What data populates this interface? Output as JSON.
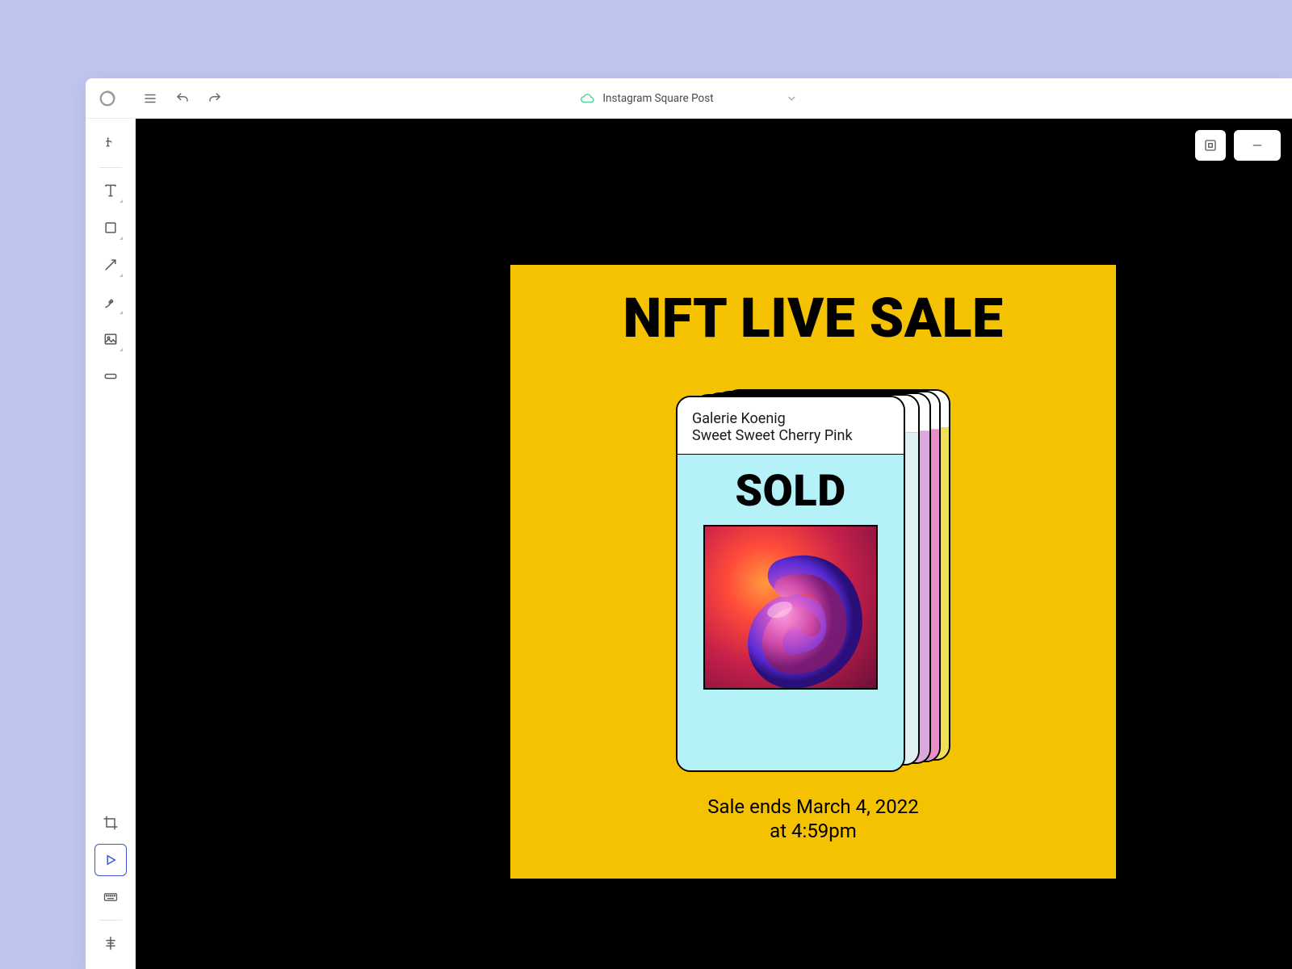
{
  "header": {
    "document_title": "Instagram Square Post"
  },
  "artboard": {
    "headline": "NFT LIVE SALE",
    "card": {
      "gallery": "Galerie Koenig",
      "title": "Sweet Sweet Cherry Pink",
      "status": "SOLD"
    },
    "sale_end_line1": "Sale ends March 4, 2022",
    "sale_end_line2": "at 4:59pm"
  },
  "colors": {
    "page_bg": "#c0c5f0",
    "canvas_bg": "#000000",
    "artboard_bg": "#f4c200",
    "card_body_bg": "#b4f2f8"
  },
  "tools": {
    "select": "select-tool",
    "text": "text-tool",
    "shape": "shape-tool",
    "line": "line-tool",
    "pen": "pen-tool",
    "image": "image-tool",
    "button": "button-tool",
    "crop": "crop-tool",
    "preview": "preview-tool",
    "keyboard": "keyboard-tool",
    "align": "align-tool"
  }
}
